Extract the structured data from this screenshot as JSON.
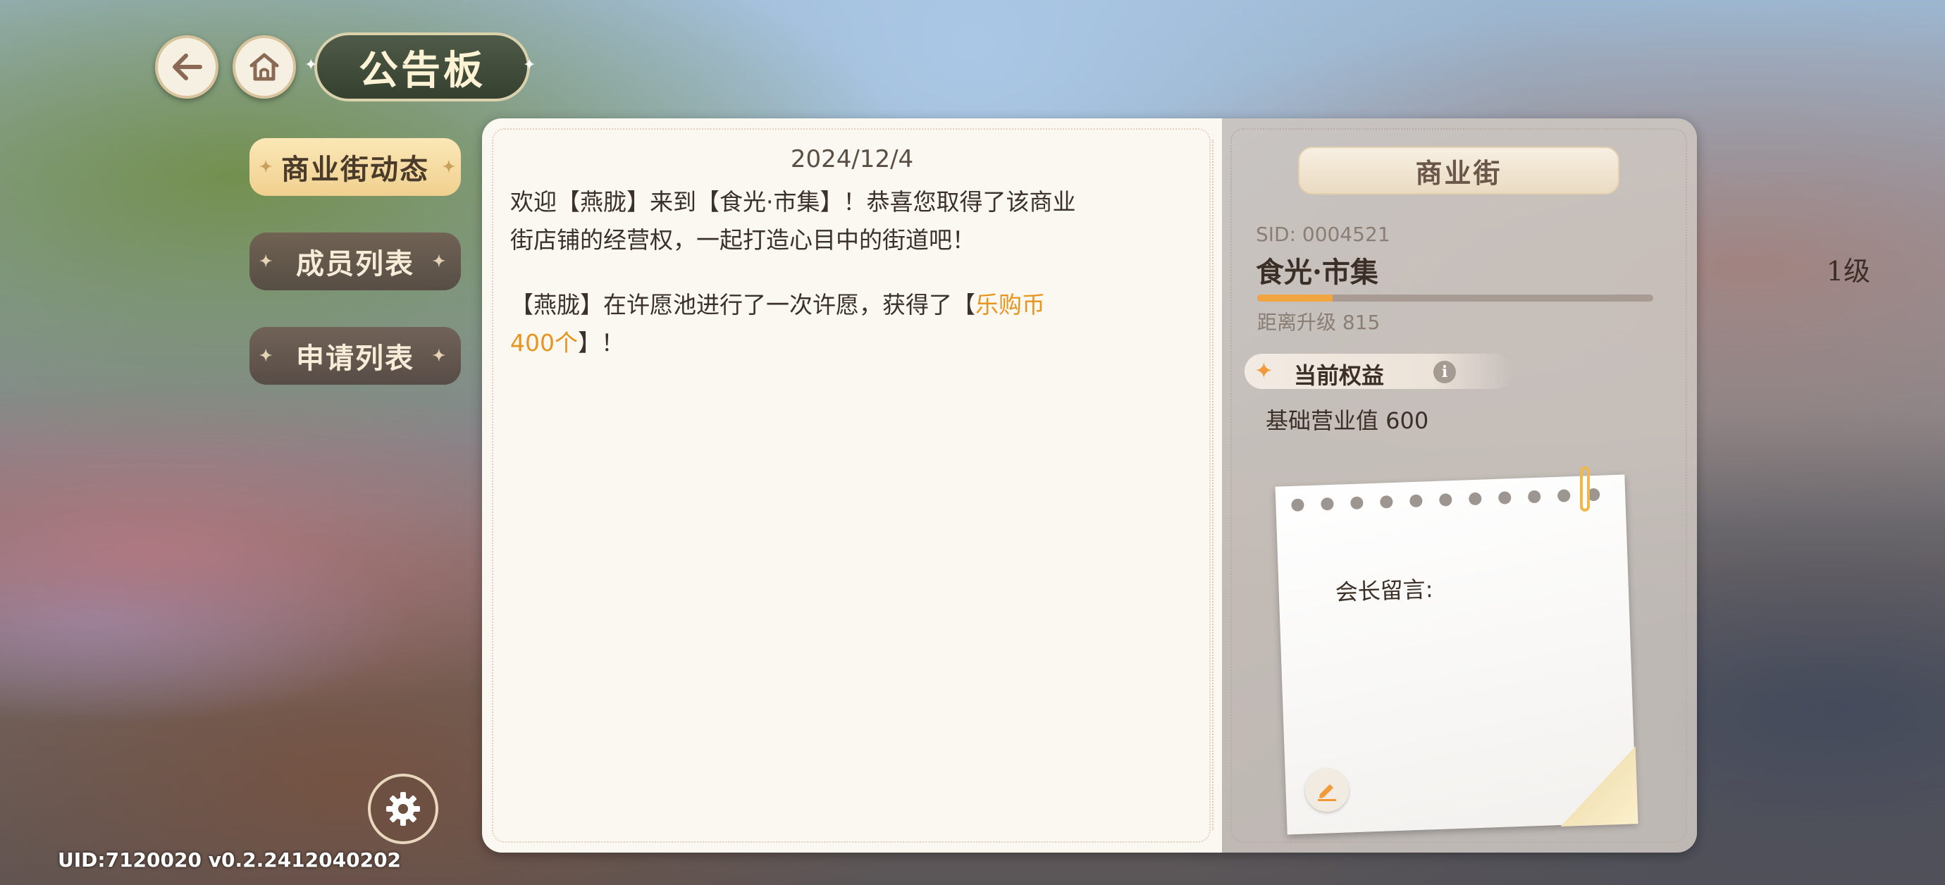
{
  "header": {
    "title": "公告板"
  },
  "tabs": [
    {
      "label": "商业街动态"
    },
    {
      "label": "成员列表"
    },
    {
      "label": "申请列表"
    }
  ],
  "board": {
    "date": "2024/12/4",
    "message1": "欢迎【燕胧】来到【食光·市集】！恭喜您取得了该商业街店铺的经营权，一起打造心目中的街道吧！",
    "message2_prefix": "【燕胧】在许愿池进行了一次许愿，获得了【",
    "message2_highlight": "乐购币400个",
    "message2_suffix": "】！"
  },
  "street": {
    "header": "商业街",
    "sid": "SID: 0004521",
    "name": "食光·市集",
    "level": "1级",
    "progress": 0.19,
    "upgrade": "距离升级 815",
    "benefit_label": "当前权益",
    "benefit_text": "基础营业值 600",
    "note_label": "会长留言:"
  },
  "footer": {
    "uid": "UID:7120020  v0.2.2412040202"
  },
  "icons": {
    "back": "back-arrow-icon",
    "home": "home-icon",
    "settings": "gear-icon",
    "edit": "pencil-icon",
    "info": "info-icon"
  },
  "colors": {
    "accent_orange": "#f2a441",
    "highlight_text": "#e8951f",
    "active_tab": "#f0d08f"
  }
}
